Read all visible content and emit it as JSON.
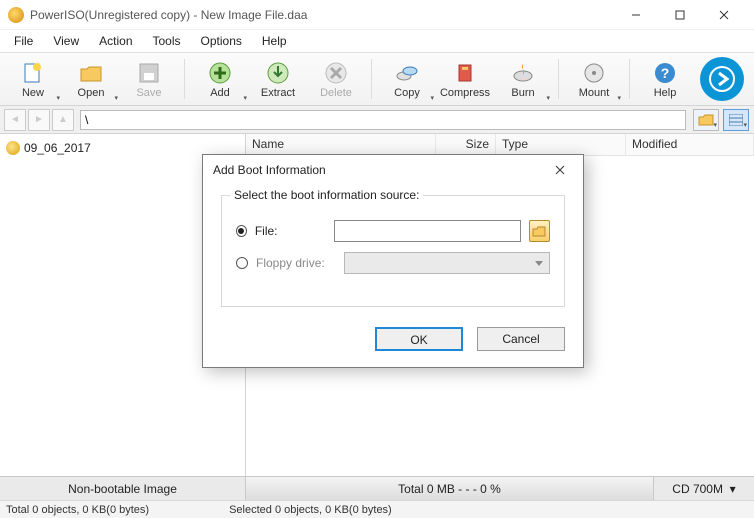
{
  "titlebar": {
    "title": "PowerISO(Unregistered copy) - New Image File.daa"
  },
  "menu": {
    "file": "File",
    "view": "View",
    "action": "Action",
    "tools": "Tools",
    "options": "Options",
    "help": "Help"
  },
  "toolbar": {
    "new": "New",
    "open": "Open",
    "save": "Save",
    "add": "Add",
    "extract": "Extract",
    "delete": "Delete",
    "copy": "Copy",
    "compress": "Compress",
    "burn": "Burn",
    "mount": "Mount",
    "help": "Help"
  },
  "path": "\\",
  "tree": {
    "root": "09_06_2017"
  },
  "columns": {
    "name": "Name",
    "size": "Size",
    "type": "Type",
    "modified": "Modified"
  },
  "status1": {
    "left": "Non-bootable Image",
    "center": "Total  0 MB    - - -  0 %",
    "right": "CD 700M"
  },
  "status2": {
    "left": "Total 0 objects, 0 KB(0 bytes)",
    "right": "Selected 0 objects, 0 KB(0 bytes)"
  },
  "dialog": {
    "title": "Add Boot Information",
    "group_label": "Select the boot information source:",
    "file_label": "File:",
    "floppy_label": "Floppy drive:",
    "file_value": "",
    "ok": "OK",
    "cancel": "Cancel"
  }
}
